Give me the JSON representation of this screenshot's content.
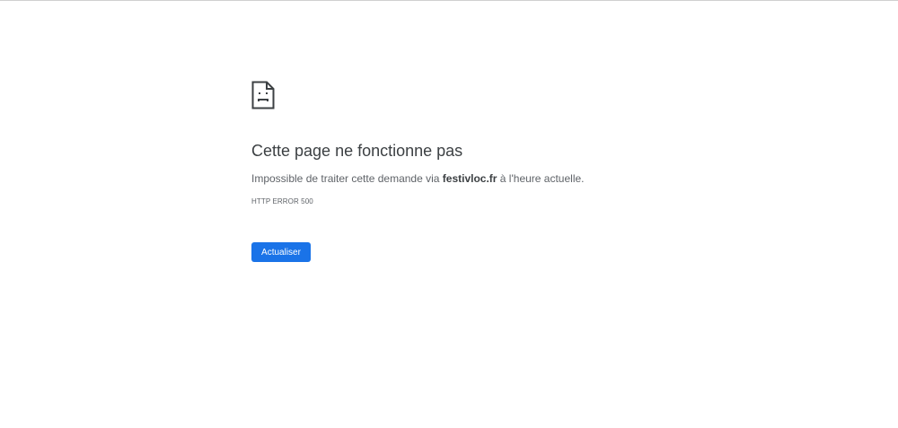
{
  "icon": "sad-document-icon",
  "title": "Cette page ne fonctionne pas",
  "message": {
    "prefix": "Impossible de traiter cette demande via ",
    "domain": "festivloc.fr",
    "suffix": " à l'heure actuelle."
  },
  "error_code": "HTTP ERROR 500",
  "reload_button": "Actualiser",
  "colors": {
    "button": "#1a73e8",
    "title": "#3c4043",
    "text": "#5f6368"
  }
}
